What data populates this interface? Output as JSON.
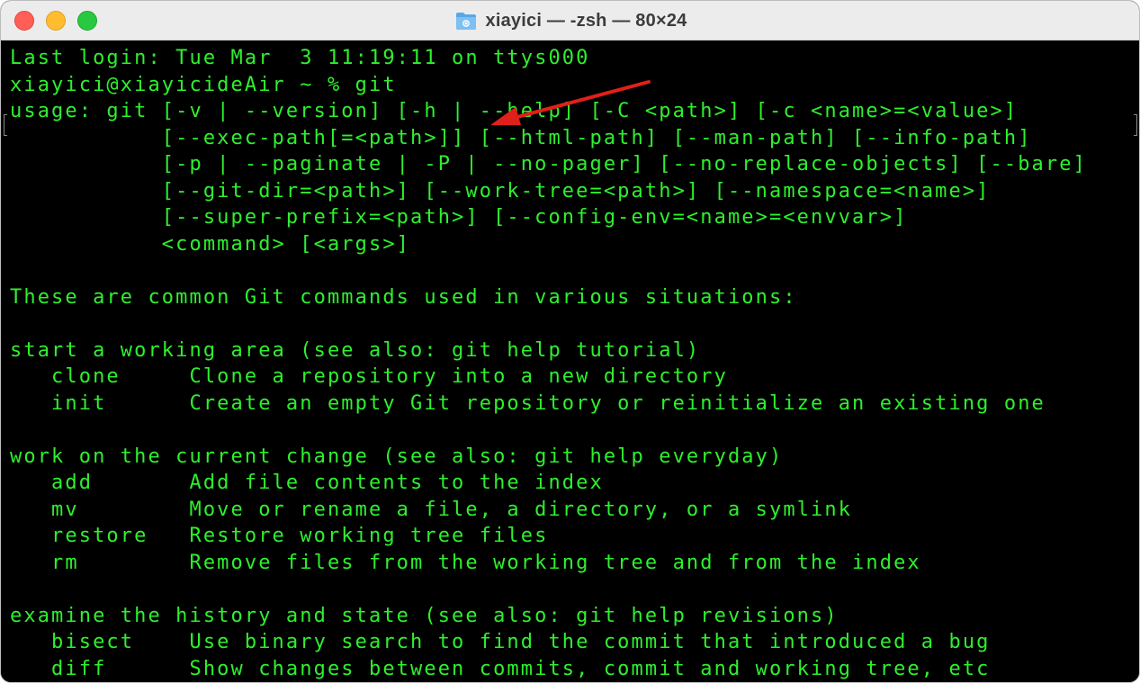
{
  "window": {
    "title": "xiayici — -zsh — 80×24",
    "icon": "folder-icon"
  },
  "terminal": {
    "lines": [
      "Last login: Tue Mar  3 11:19:11 on ttys000",
      "xiayici@xiayicideAir ~ % git",
      "usage: git [-v | --version] [-h | --help] [-C <path>] [-c <name>=<value>]",
      "           [--exec-path[=<path>]] [--html-path] [--man-path] [--info-path]",
      "           [-p | --paginate | -P | --no-pager] [--no-replace-objects] [--bare]",
      "           [--git-dir=<path>] [--work-tree=<path>] [--namespace=<name>]",
      "           [--super-prefix=<path>] [--config-env=<name>=<envvar>]",
      "           <command> [<args>]",
      "",
      "These are common Git commands used in various situations:",
      "",
      "start a working area (see also: git help tutorial)",
      "   clone     Clone a repository into a new directory",
      "   init      Create an empty Git repository or reinitialize an existing one",
      "",
      "work on the current change (see also: git help everyday)",
      "   add       Add file contents to the index",
      "   mv        Move or rename a file, a directory, or a symlink",
      "   restore   Restore working tree files",
      "   rm        Remove files from the working tree and from the index",
      "",
      "examine the history and state (see also: git help revisions)",
      "   bisect    Use binary search to find the commit that introduced a bug",
      "   diff      Show changes between commits, commit and working tree, etc"
    ]
  },
  "colors": {
    "terminal_bg": "#000000",
    "terminal_fg": "#2ef02e",
    "annotation_arrow": "#e0201a"
  }
}
